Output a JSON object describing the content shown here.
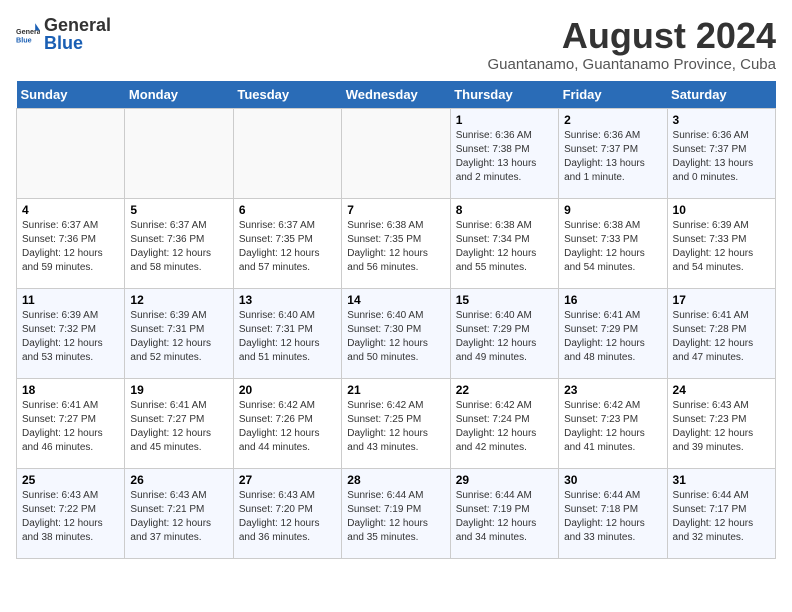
{
  "header": {
    "logo_general": "General",
    "logo_blue": "Blue",
    "month_year": "August 2024",
    "location": "Guantanamo, Guantanamo Province, Cuba"
  },
  "calendar": {
    "weekdays": [
      "Sunday",
      "Monday",
      "Tuesday",
      "Wednesday",
      "Thursday",
      "Friday",
      "Saturday"
    ],
    "weeks": [
      [
        {
          "day": "",
          "info": ""
        },
        {
          "day": "",
          "info": ""
        },
        {
          "day": "",
          "info": ""
        },
        {
          "day": "",
          "info": ""
        },
        {
          "day": "1",
          "info": "Sunrise: 6:36 AM\nSunset: 7:38 PM\nDaylight: 13 hours\nand 2 minutes."
        },
        {
          "day": "2",
          "info": "Sunrise: 6:36 AM\nSunset: 7:37 PM\nDaylight: 13 hours\nand 1 minute."
        },
        {
          "day": "3",
          "info": "Sunrise: 6:36 AM\nSunset: 7:37 PM\nDaylight: 13 hours\nand 0 minutes."
        }
      ],
      [
        {
          "day": "4",
          "info": "Sunrise: 6:37 AM\nSunset: 7:36 PM\nDaylight: 12 hours\nand 59 minutes."
        },
        {
          "day": "5",
          "info": "Sunrise: 6:37 AM\nSunset: 7:36 PM\nDaylight: 12 hours\nand 58 minutes."
        },
        {
          "day": "6",
          "info": "Sunrise: 6:37 AM\nSunset: 7:35 PM\nDaylight: 12 hours\nand 57 minutes."
        },
        {
          "day": "7",
          "info": "Sunrise: 6:38 AM\nSunset: 7:35 PM\nDaylight: 12 hours\nand 56 minutes."
        },
        {
          "day": "8",
          "info": "Sunrise: 6:38 AM\nSunset: 7:34 PM\nDaylight: 12 hours\nand 55 minutes."
        },
        {
          "day": "9",
          "info": "Sunrise: 6:38 AM\nSunset: 7:33 PM\nDaylight: 12 hours\nand 54 minutes."
        },
        {
          "day": "10",
          "info": "Sunrise: 6:39 AM\nSunset: 7:33 PM\nDaylight: 12 hours\nand 54 minutes."
        }
      ],
      [
        {
          "day": "11",
          "info": "Sunrise: 6:39 AM\nSunset: 7:32 PM\nDaylight: 12 hours\nand 53 minutes."
        },
        {
          "day": "12",
          "info": "Sunrise: 6:39 AM\nSunset: 7:31 PM\nDaylight: 12 hours\nand 52 minutes."
        },
        {
          "day": "13",
          "info": "Sunrise: 6:40 AM\nSunset: 7:31 PM\nDaylight: 12 hours\nand 51 minutes."
        },
        {
          "day": "14",
          "info": "Sunrise: 6:40 AM\nSunset: 7:30 PM\nDaylight: 12 hours\nand 50 minutes."
        },
        {
          "day": "15",
          "info": "Sunrise: 6:40 AM\nSunset: 7:29 PM\nDaylight: 12 hours\nand 49 minutes."
        },
        {
          "day": "16",
          "info": "Sunrise: 6:41 AM\nSunset: 7:29 PM\nDaylight: 12 hours\nand 48 minutes."
        },
        {
          "day": "17",
          "info": "Sunrise: 6:41 AM\nSunset: 7:28 PM\nDaylight: 12 hours\nand 47 minutes."
        }
      ],
      [
        {
          "day": "18",
          "info": "Sunrise: 6:41 AM\nSunset: 7:27 PM\nDaylight: 12 hours\nand 46 minutes."
        },
        {
          "day": "19",
          "info": "Sunrise: 6:41 AM\nSunset: 7:27 PM\nDaylight: 12 hours\nand 45 minutes."
        },
        {
          "day": "20",
          "info": "Sunrise: 6:42 AM\nSunset: 7:26 PM\nDaylight: 12 hours\nand 44 minutes."
        },
        {
          "day": "21",
          "info": "Sunrise: 6:42 AM\nSunset: 7:25 PM\nDaylight: 12 hours\nand 43 minutes."
        },
        {
          "day": "22",
          "info": "Sunrise: 6:42 AM\nSunset: 7:24 PM\nDaylight: 12 hours\nand 42 minutes."
        },
        {
          "day": "23",
          "info": "Sunrise: 6:42 AM\nSunset: 7:23 PM\nDaylight: 12 hours\nand 41 minutes."
        },
        {
          "day": "24",
          "info": "Sunrise: 6:43 AM\nSunset: 7:23 PM\nDaylight: 12 hours\nand 39 minutes."
        }
      ],
      [
        {
          "day": "25",
          "info": "Sunrise: 6:43 AM\nSunset: 7:22 PM\nDaylight: 12 hours\nand 38 minutes."
        },
        {
          "day": "26",
          "info": "Sunrise: 6:43 AM\nSunset: 7:21 PM\nDaylight: 12 hours\nand 37 minutes."
        },
        {
          "day": "27",
          "info": "Sunrise: 6:43 AM\nSunset: 7:20 PM\nDaylight: 12 hours\nand 36 minutes."
        },
        {
          "day": "28",
          "info": "Sunrise: 6:44 AM\nSunset: 7:19 PM\nDaylight: 12 hours\nand 35 minutes."
        },
        {
          "day": "29",
          "info": "Sunrise: 6:44 AM\nSunset: 7:19 PM\nDaylight: 12 hours\nand 34 minutes."
        },
        {
          "day": "30",
          "info": "Sunrise: 6:44 AM\nSunset: 7:18 PM\nDaylight: 12 hours\nand 33 minutes."
        },
        {
          "day": "31",
          "info": "Sunrise: 6:44 AM\nSunset: 7:17 PM\nDaylight: 12 hours\nand 32 minutes."
        }
      ]
    ]
  }
}
